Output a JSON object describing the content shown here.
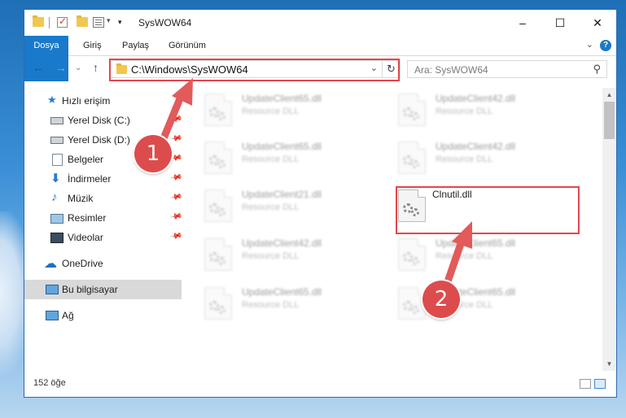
{
  "window": {
    "title": "SysWOW64",
    "controls": {
      "minimize": "–",
      "maximize": "☐",
      "close": "✕"
    }
  },
  "ribbon": {
    "tabs": [
      "Dosya",
      "Giriş",
      "Paylaş",
      "Görünüm"
    ],
    "collapse_glyph": "⌄",
    "help_glyph": "?"
  },
  "navbar": {
    "back_glyph": "←",
    "forward_glyph": "→",
    "recent_glyph": "⌄",
    "up_glyph": "↑",
    "address": "C:\\Windows\\SysWOW64",
    "address_dropdown_glyph": "⌄",
    "refresh_glyph": "↻",
    "search_placeholder": "Ara: SysWOW64",
    "search_glyph": "⚲"
  },
  "sidebar": {
    "quick_access": "Hızlı erişim",
    "items": [
      {
        "label": "Yerel Disk (C:)",
        "icon": "drive-icon",
        "pinned": true
      },
      {
        "label": "Yerel Disk (D:)",
        "icon": "drive-icon",
        "pinned": true
      },
      {
        "label": "Belgeler",
        "icon": "documents-icon",
        "pinned": true
      },
      {
        "label": "İndirmeler",
        "icon": "downloads-icon",
        "pinned": true
      },
      {
        "label": "Müzik",
        "icon": "music-icon",
        "pinned": true
      },
      {
        "label": "Resimler",
        "icon": "pictures-icon",
        "pinned": true
      },
      {
        "label": "Videolar",
        "icon": "videos-icon",
        "pinned": true
      }
    ],
    "onedrive": "OneDrive",
    "this_pc": "Bu bilgisayar",
    "network": "Ağ"
  },
  "files": [
    {
      "name": "UpdateClient65.dll",
      "type": "Resource DLL",
      "blurred": true
    },
    {
      "name": "UpdateClient42.dll",
      "type": "Resource DLL",
      "blurred": true
    },
    {
      "name": "UpdateClient65.dll",
      "type": "Resource DLL",
      "blurred": true
    },
    {
      "name": "UpdateClient42.dll",
      "type": "Resource DLL",
      "blurred": true
    },
    {
      "name": "UpdateClient21.dll",
      "type": "Resource DLL",
      "blurred": true
    },
    {
      "name": "Clnutil.dll",
      "type": "",
      "blurred": false
    },
    {
      "name": "UpdateClient42.dll",
      "type": "Resource DLL",
      "blurred": true
    },
    {
      "name": "UpdateClient65.dll",
      "type": "Resource DLL",
      "blurred": true
    },
    {
      "name": "UpdateClient65.dll",
      "type": "Resource DLL",
      "blurred": true
    },
    {
      "name": "UpdateClient65.dll",
      "type": "Resource DLL",
      "blurred": true
    }
  ],
  "status": {
    "item_count": "152 öğe"
  },
  "annotations": {
    "marker_1": "1",
    "marker_2": "2",
    "highlight_color": "#e0474c",
    "marker_color": "#dd4c4c"
  },
  "colors": {
    "file_tab": "#1979ca",
    "selected_nav": "#d9d9d9"
  }
}
